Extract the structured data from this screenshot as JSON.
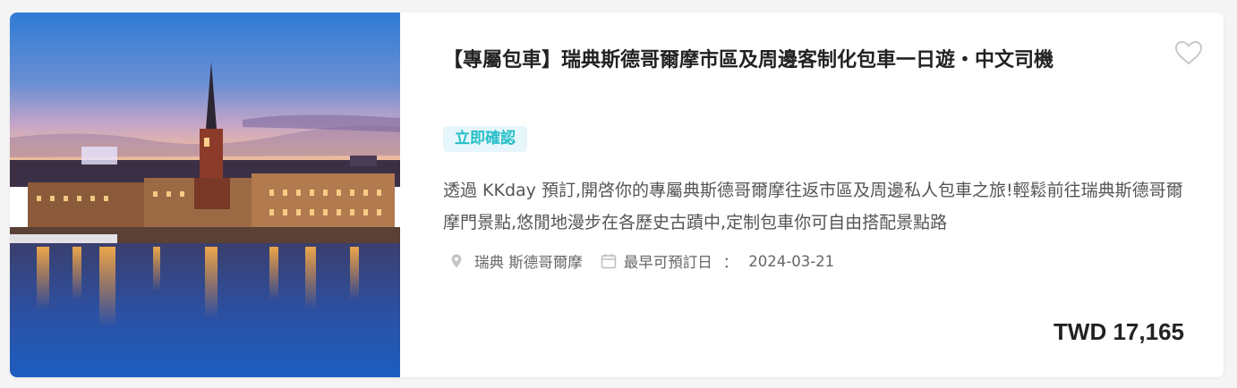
{
  "product": {
    "title": "【專屬包車】瑞典斯德哥爾摩市區及周邊客制化包車一日遊・中文司機",
    "badge": "立即確認",
    "description": "透過 KKday 預訂,開啓你的專屬典斯德哥爾摩往返市區及周邊私人包車之旅!輕鬆前往瑞典斯德哥爾摩門景點,悠閒地漫步在各歷史古蹟中,定制包車你可自由搭配景點路",
    "location": "瑞典 斯德哥爾摩",
    "earliest_date_label": "最早可預訂日",
    "earliest_date_sep": "：",
    "earliest_date": "2024-03-21",
    "price": "TWD 17,165"
  },
  "icons": {
    "favorite": "heart-outline-icon",
    "location": "map-pin-icon",
    "calendar": "calendar-icon"
  },
  "colors": {
    "badge_text": "#26bec9",
    "badge_bg": "#e6f6fa",
    "title": "#222222",
    "description": "#555555"
  }
}
